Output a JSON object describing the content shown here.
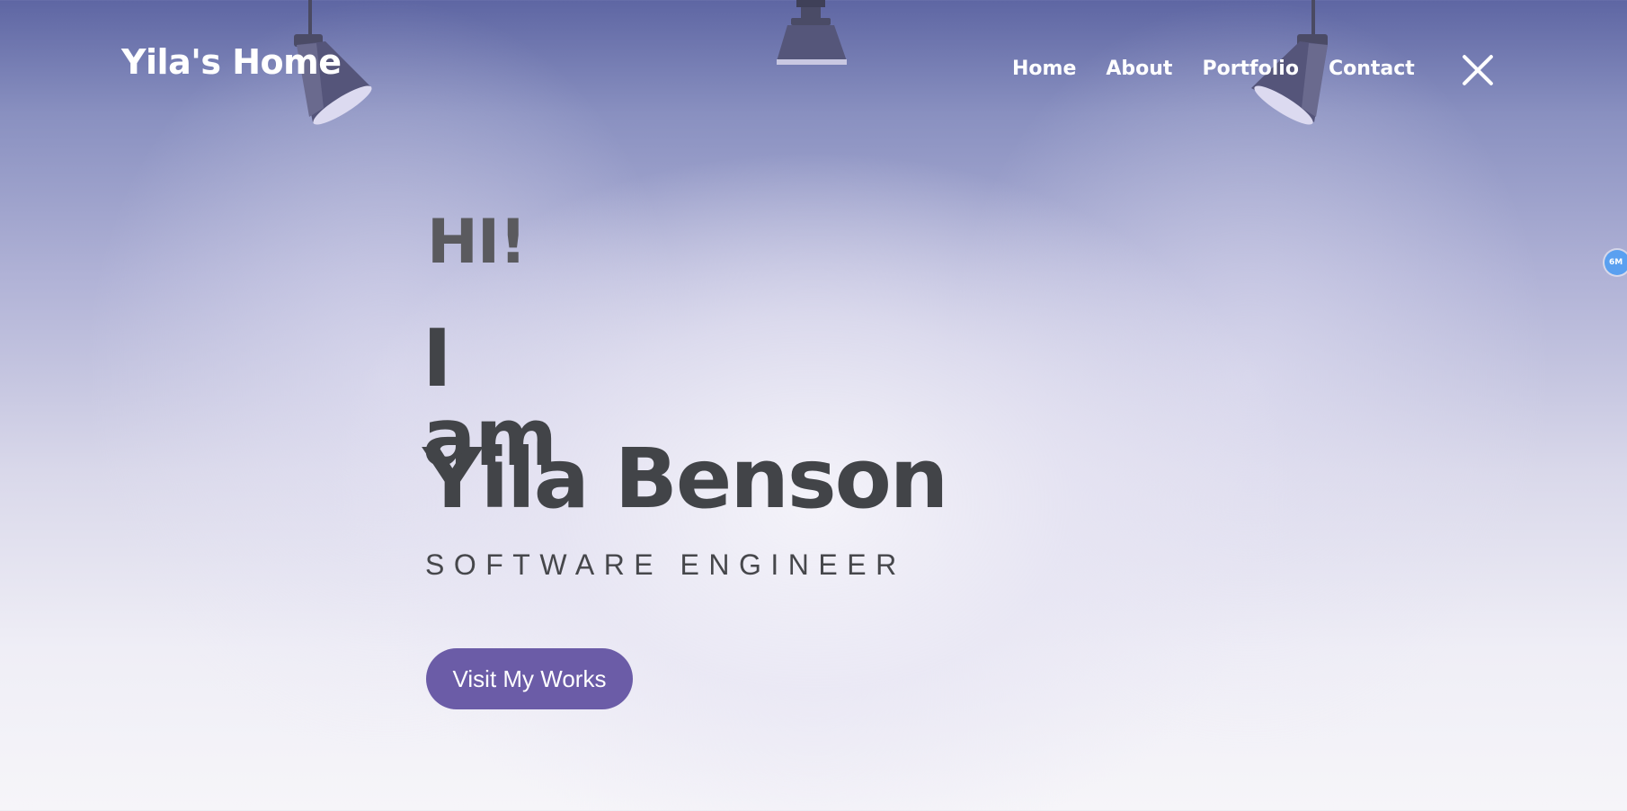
{
  "header": {
    "logo": "Yila's Home",
    "nav": [
      "Home",
      "About",
      "Portfolio",
      "Contact"
    ],
    "close_icon": "close-icon"
  },
  "hero": {
    "greeting": "HI!",
    "intro": "I am",
    "name": "Yila Benson",
    "role": "SOFTWARE ENGINEER",
    "cta_label": "Visit My Works"
  },
  "badge": {
    "label": "6M",
    "color": "#5aa0f0"
  },
  "colors": {
    "accent": "#6b5ca7",
    "heading": "#424448",
    "nav_text": "#ffffff"
  }
}
